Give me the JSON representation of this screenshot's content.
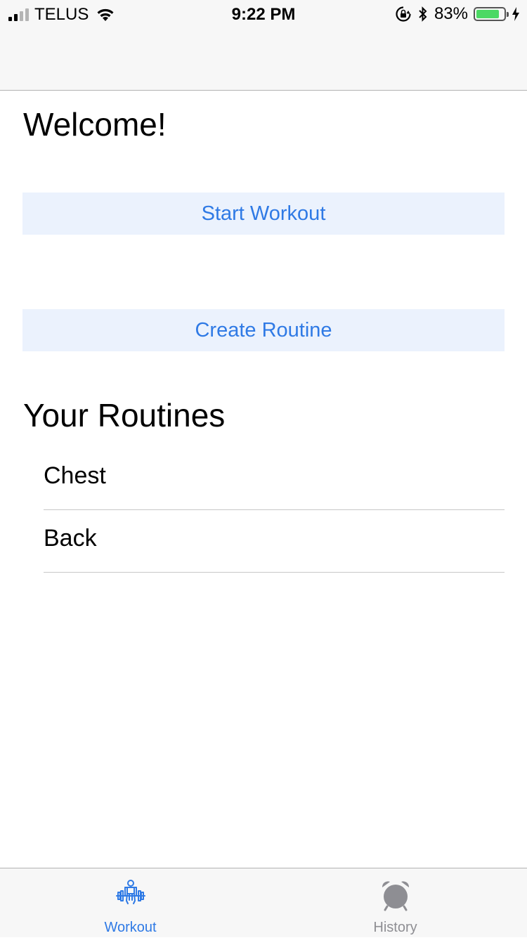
{
  "status_bar": {
    "carrier": "TELUS",
    "time": "9:22 PM",
    "battery_percent": "83%",
    "battery_level": 0.83,
    "signal_strength_bars": 2,
    "icons": [
      "signal-icon",
      "wifi-icon",
      "rotation-lock-icon",
      "bluetooth-icon",
      "battery-icon",
      "charging-icon"
    ]
  },
  "main": {
    "welcome_title": "Welcome!",
    "start_workout_label": "Start Workout",
    "create_routine_label": "Create Routine",
    "routines_title": "Your Routines",
    "routines": [
      {
        "name": "Chest"
      },
      {
        "name": "Back"
      }
    ]
  },
  "tab_bar": {
    "tabs": [
      {
        "label": "Workout",
        "icon": "weightlifter-icon",
        "selected": true
      },
      {
        "label": "History",
        "icon": "alarm-clock-icon",
        "selected": false
      }
    ]
  },
  "colors": {
    "accent": "#2f7ae5",
    "button_background": "#ebf2fd",
    "bar_background": "#f7f7f7",
    "inactive_tab": "#8e8e93",
    "battery_green": "#4cd964"
  }
}
